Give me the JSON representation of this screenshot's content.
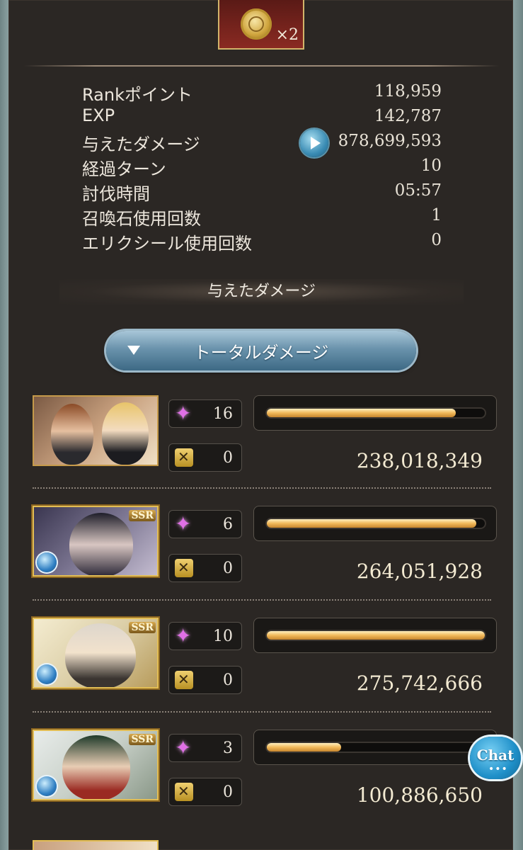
{
  "reward": {
    "icon": "gold-medal-icon",
    "count": "×2"
  },
  "stats": [
    {
      "label": "Rankポイント",
      "value": "118,959"
    },
    {
      "label": "EXP",
      "value": "142,787"
    },
    {
      "label": "与えたダメージ",
      "value": "878,699,593",
      "has_play": true
    },
    {
      "label": "経過ターン",
      "value": "10"
    },
    {
      "label": "討伐時間",
      "value": "05:57"
    },
    {
      "label": "召喚石使用回数",
      "value": "1"
    },
    {
      "label": "エリクシール使用回数",
      "value": "0"
    }
  ],
  "section_title": "与えたダメージ",
  "total_button": "トータルダメージ",
  "characters": [
    {
      "star_count": "16",
      "sword_count": "0",
      "damage": "238,018,349",
      "bar_fill": 0.87,
      "ssr": false,
      "element": ""
    },
    {
      "star_count": "6",
      "sword_count": "0",
      "damage": "264,051,928",
      "bar_fill": 0.96,
      "ssr": true,
      "ssr_label": "SSR",
      "element": "water"
    },
    {
      "star_count": "10",
      "sword_count": "0",
      "damage": "275,742,666",
      "bar_fill": 1.0,
      "ssr": true,
      "ssr_label": "SSR",
      "element": "water"
    },
    {
      "star_count": "3",
      "sword_count": "0",
      "damage": "100,886,650",
      "bar_fill": 0.35,
      "ssr": true,
      "ssr_label": "SSR",
      "element": "water"
    }
  ],
  "chat": {
    "label": "Chat",
    "dots": "•••"
  },
  "colors": {
    "bar": "#f1b95a",
    "panel": "#2b2724",
    "accent_teal": "#8aa0a0"
  }
}
